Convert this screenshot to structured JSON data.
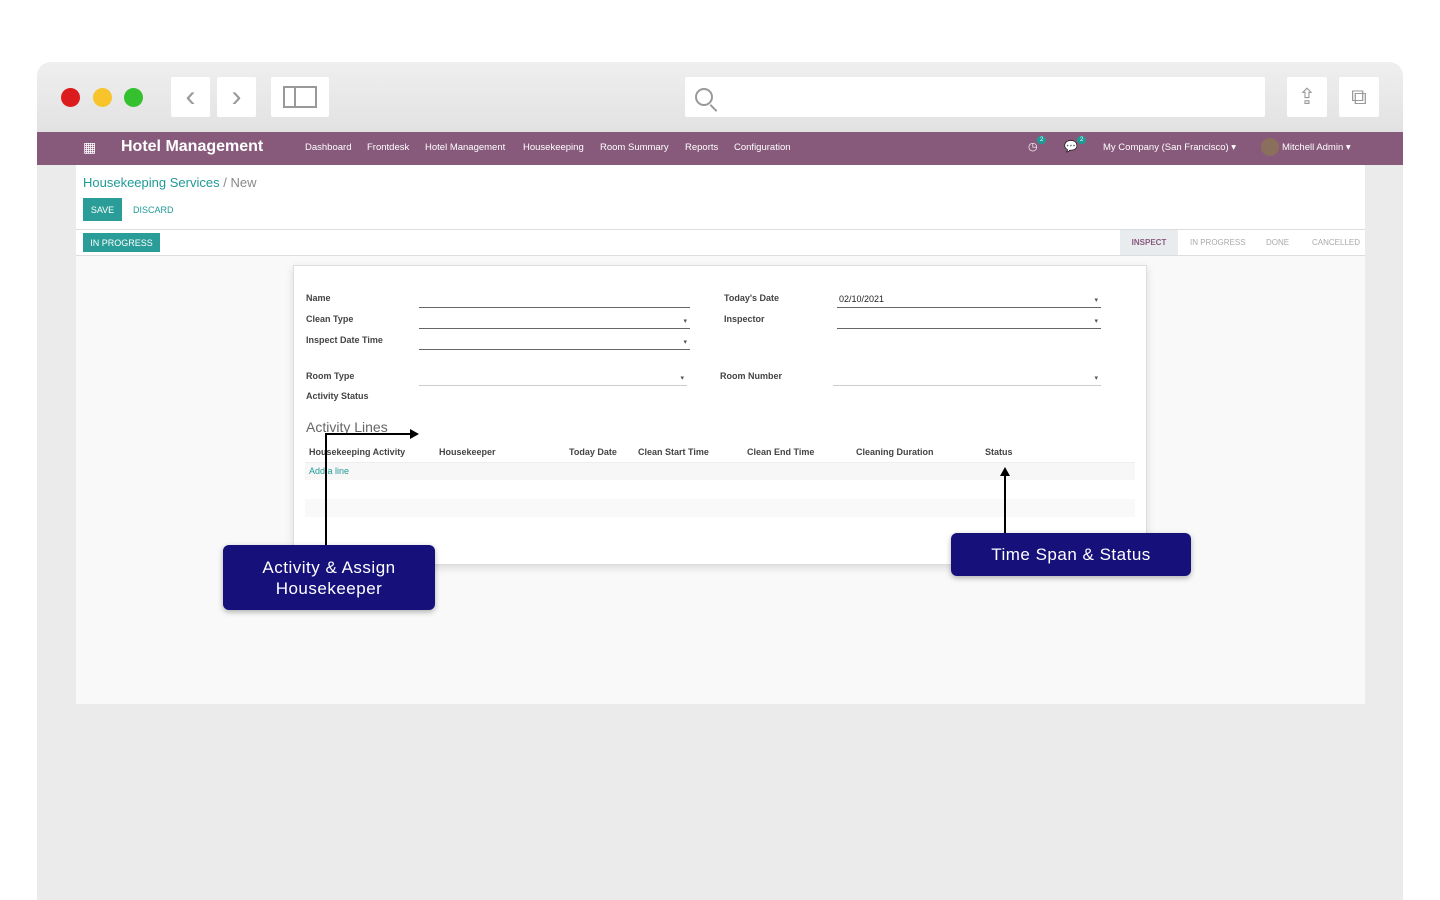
{
  "app": {
    "title": "Hotel Management",
    "menu": [
      "Dashboard",
      "Frontdesk",
      "Hotel Management",
      "Housekeeping",
      "Room Summary",
      "Reports",
      "Configuration"
    ],
    "activity_count": "2",
    "message_count": "2",
    "company": "My Company (San Francisco)",
    "user": "Mitchell Admin"
  },
  "breadcrumb": {
    "parent": "Housekeeping Services",
    "sep": "/",
    "current": "New"
  },
  "actions": {
    "save": "SAVE",
    "discard": "DISCARD"
  },
  "status": {
    "button": "IN PROGRESS",
    "stages": [
      "INSPECT",
      "IN PROGRESS",
      "DONE",
      "CANCELLED"
    ],
    "active": "INSPECT"
  },
  "form": {
    "name_label": "Name",
    "clean_type_label": "Clean Type",
    "inspect_dt_label": "Inspect Date Time",
    "today_label": "Today's Date",
    "today_value": "02/10/2021",
    "inspector_label": "Inspector",
    "room_type_label": "Room Type",
    "room_number_label": "Room Number",
    "activity_status_label": "Activity Status"
  },
  "lines": {
    "title": "Activity Lines",
    "columns": [
      "Housekeeping Activity",
      "Housekeeper",
      "Today Date",
      "Clean Start Time",
      "Clean End Time",
      "Cleaning Duration",
      "Status"
    ],
    "add": "Add a line"
  },
  "callouts": {
    "left": "Activity & Assign Housekeeper",
    "right": "Time Span & Status"
  },
  "colors": {
    "nav": "#875a7b",
    "accent": "#1f9a96",
    "callout": "#16117a"
  }
}
